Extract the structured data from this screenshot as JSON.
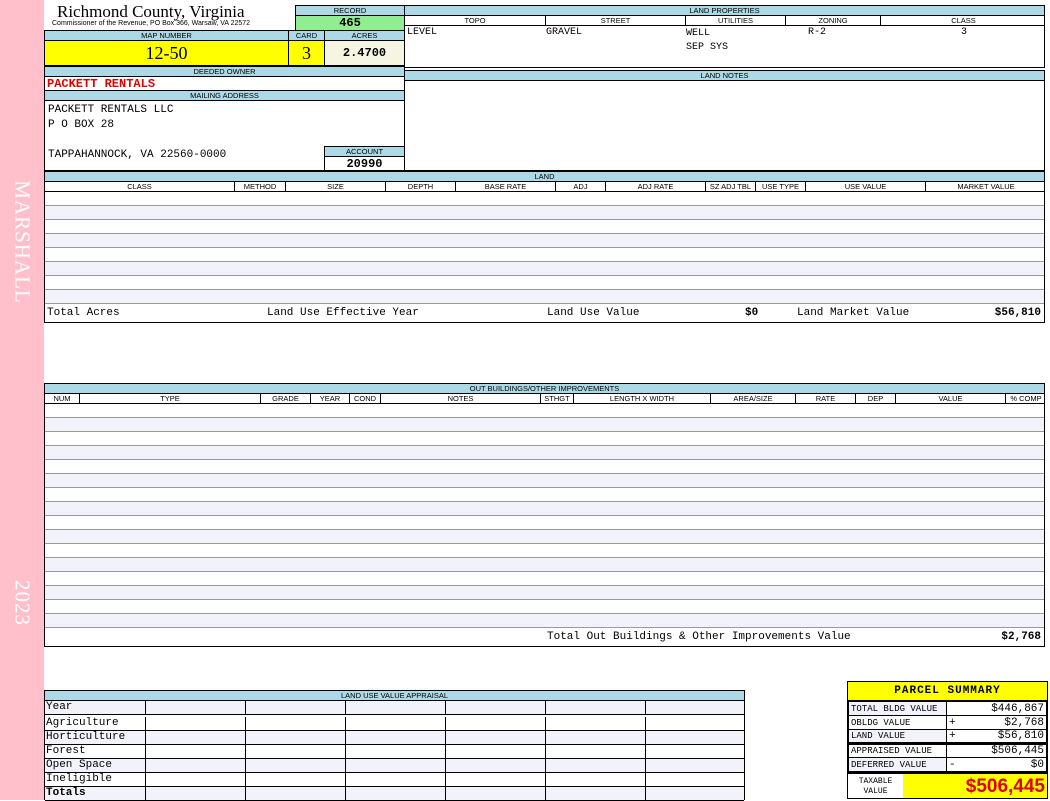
{
  "sidebar": {
    "neighborhood": "MARSHALL",
    "year": "2023",
    "color": "#ffc0cb"
  },
  "header": {
    "title": "Richmond County, Virginia",
    "subtitle": "Commissioner of the Revenue, PO Box 366, Warsaw, VA 22572"
  },
  "record": {
    "label": "RECORD",
    "value": "465"
  },
  "map_number": {
    "label": "MAP NUMBER",
    "value": "12-50"
  },
  "card": {
    "label": "CARD",
    "value": "3"
  },
  "acres": {
    "label": "ACRES",
    "value": "2.4700"
  },
  "owner": {
    "label": "DEEDED OWNER",
    "value": "PACKETT RENTALS"
  },
  "mailing": {
    "label": "MAILING ADDRESS",
    "line1": "PACKETT RENTALS LLC",
    "line2": "P O BOX 28",
    "line3": "TAPPAHANNOCK, VA 22560-0000"
  },
  "account": {
    "label": "ACCOUNT",
    "value": "20990"
  },
  "land_properties": {
    "title": "LAND PROPERTIES",
    "headers": [
      "TOPO",
      "STREET",
      "UTILITIES",
      "ZONING",
      "CLASS"
    ],
    "topo": "LEVEL",
    "street": "GRAVEL",
    "utilities1": "WELL",
    "utilities2": "SEP SYS",
    "zoning": "R-2",
    "class": "3"
  },
  "land_notes": {
    "title": "LAND NOTES"
  },
  "land": {
    "title": "LAND",
    "headers": [
      "CLASS",
      "METHOD",
      "SIZE",
      "DEPTH",
      "BASE RATE",
      "ADJ",
      "ADJ RATE",
      "SZ ADJ TBL",
      "USE TYPE",
      "USE VALUE",
      "MARKET VALUE"
    ],
    "total_acres_label": "Total Acres",
    "effective_year_label": "Land Use Effective Year",
    "use_value_label": "Land Use Value",
    "use_value": "$0",
    "market_value_label": "Land Market Value",
    "market_value": "$56,810"
  },
  "outbuildings": {
    "title": "OUT BUILDINGS/OTHER IMPROVEMENTS",
    "headers": [
      "NUM",
      "TYPE",
      "GRADE",
      "YEAR",
      "COND",
      "NOTES",
      "STHGT",
      "LENGTH X WIDTH",
      "AREA/SIZE",
      "RATE",
      "DEP",
      "VALUE",
      "% COMP"
    ],
    "total_label": "Total Out Buildings & Other Improvements Value",
    "total_value": "$2,768"
  },
  "land_use_appraisal": {
    "title": "LAND USE VALUE APPRAISAL",
    "rows": [
      "Year",
      "Agriculture",
      "Horticulture",
      "Forest",
      "Open Space",
      "Ineligible",
      "Totals"
    ]
  },
  "parcel_summary": {
    "title": "PARCEL SUMMARY",
    "rows": [
      {
        "label": "TOTAL BLDG VALUE",
        "sign": "",
        "value": "$446,867"
      },
      {
        "label": "OBLDG VALUE",
        "sign": "+",
        "value": "$2,768"
      },
      {
        "label": "LAND VALUE",
        "sign": "+",
        "value": "$56,810"
      },
      {
        "label": "APPRAISED VALUE",
        "sign": "",
        "value": "$506,445"
      },
      {
        "label": "DEFERRED VALUE",
        "sign": "-",
        "value": "$0"
      }
    ],
    "taxable_label": "TAXABLE VALUE",
    "taxable_value": "$506,445"
  },
  "colors": {
    "header_blue": "#add8e6",
    "highlight_yellow": "#ffff00",
    "record_green": "#90ee90",
    "owner_red": "#e00000",
    "alt_row": "#f2f2fb"
  }
}
